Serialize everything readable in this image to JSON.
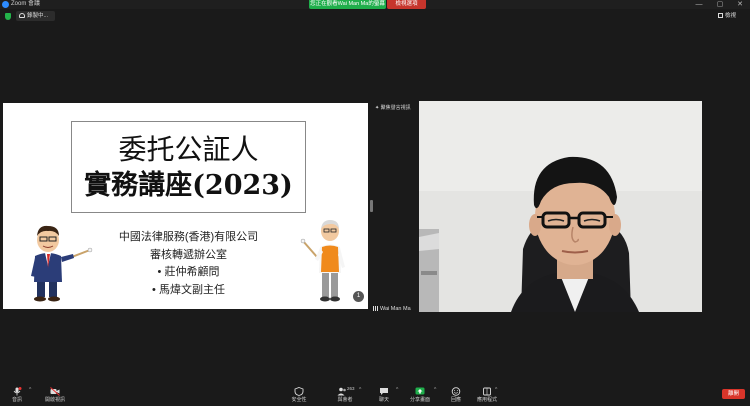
{
  "window": {
    "title": "Zoom 會議",
    "share_notice": "您正在觀看Wai Man Ma的螢幕",
    "view_options": "檢視選項",
    "controls": [
      "—",
      "▢",
      "✕"
    ]
  },
  "top_bar": {
    "recording_label": "錄製中...",
    "view_label": "檢視"
  },
  "slide": {
    "title_line1": "委托公証人",
    "title_line2": "實務講座(2023)",
    "org": "中國法律服務(香港)有限公司",
    "office": "審核轉遞辦公室",
    "speaker1": "• 莊仲希顧問",
    "speaker2": "• 馬煒文副主任",
    "page_number": "1"
  },
  "camera": {
    "header": "聚焦發言視訊",
    "participant_name": "Wai Man Ma"
  },
  "toolbar": {
    "audio_label": "音訊",
    "video_label": "開啟視訊",
    "security_label": "安全性",
    "participants_label": "與會者",
    "participants_count": "263",
    "chat_label": "聊天",
    "share_label": "分享畫面",
    "reactions_label": "回應",
    "apps_label": "應用程式",
    "end_label": "離開"
  },
  "colors": {
    "accent_blue": "#2d8cff",
    "share_green": "#1fae4b",
    "end_red": "#d9352a",
    "background": "#1a1a1a"
  }
}
